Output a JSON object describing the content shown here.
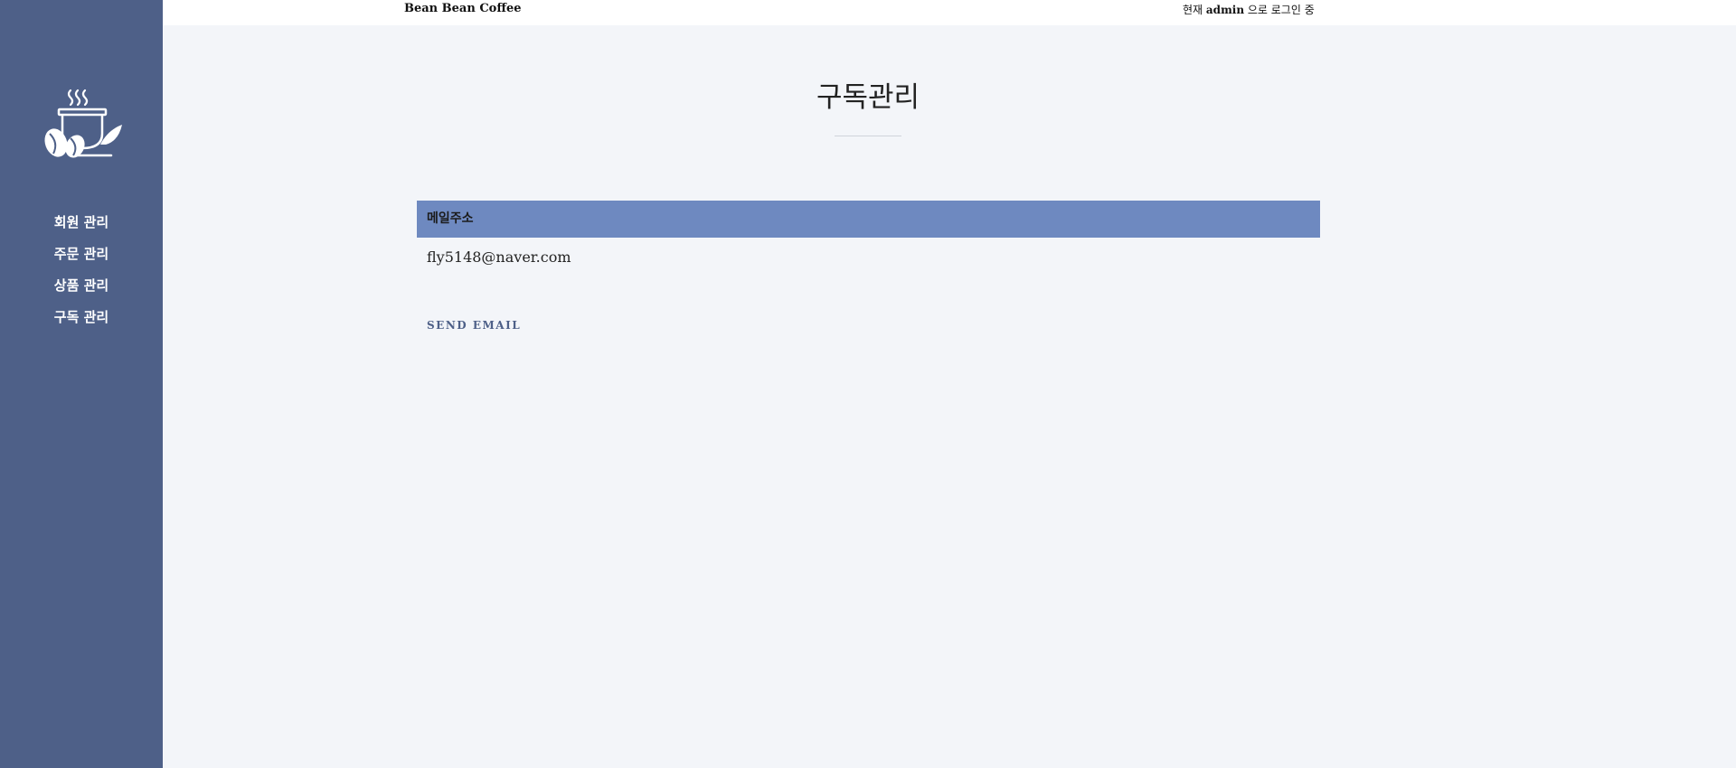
{
  "header": {
    "brand": "Bean Bean Coffee",
    "login_prefix": "현재 ",
    "login_user": "admin",
    "login_suffix": " 으로 로그인 중"
  },
  "sidebar": {
    "logo_icon": "coffee-cup-beans-icon",
    "items": [
      {
        "label": "회원 관리"
      },
      {
        "label": "주문 관리"
      },
      {
        "label": "상품 관리"
      },
      {
        "label": "구독 관리"
      }
    ]
  },
  "main": {
    "title": "구독관리",
    "table": {
      "header": "메일주소",
      "rows": [
        {
          "email": "fly5148@naver.com"
        }
      ]
    },
    "send_button": "SEND EMAIL"
  },
  "colors": {
    "sidebar": "#4e6088",
    "table_header": "#6e89c0",
    "background": "#f3f5f9"
  }
}
